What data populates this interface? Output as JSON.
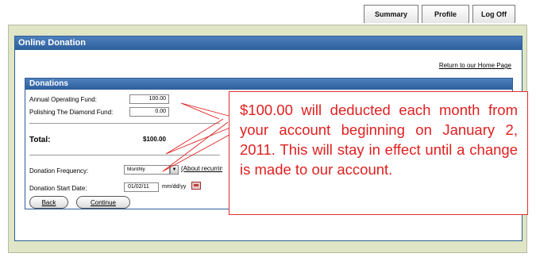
{
  "tabs": [
    {
      "label": "Summary"
    },
    {
      "label": "Profile"
    },
    {
      "label": "Log Off"
    }
  ],
  "panel": {
    "title": "Online Donation",
    "home_link": "Return to our Home Page"
  },
  "donations": {
    "title": "Donations",
    "funds": [
      {
        "label": "Annual Operating Fund:",
        "value": "100.00"
      },
      {
        "label": "Polishing The Diamond Fund:",
        "value": "0.00"
      }
    ],
    "total_label": "Total:",
    "total_value": "$100.00",
    "frequency_label": "Donation Frequency:",
    "frequency_value": "Monthly",
    "about_link": "(About recurring",
    "start_label": "Donation Start Date:",
    "start_value": "01/02/11",
    "date_format": "mm/dd/yy",
    "back_label": "Back",
    "continue_label": "Continue"
  },
  "callout": {
    "text": "$100.00 will deducted each month from your account beginning on January 2, 2011. This will stay in effect until a change is made to our account."
  },
  "colors": {
    "header_blue": "#2c5e9c",
    "outer_green": "#dfe5c5",
    "callout_red": "#e02020"
  },
  "icons": [
    "dropdown-arrow-icon",
    "calendar-icon"
  ]
}
